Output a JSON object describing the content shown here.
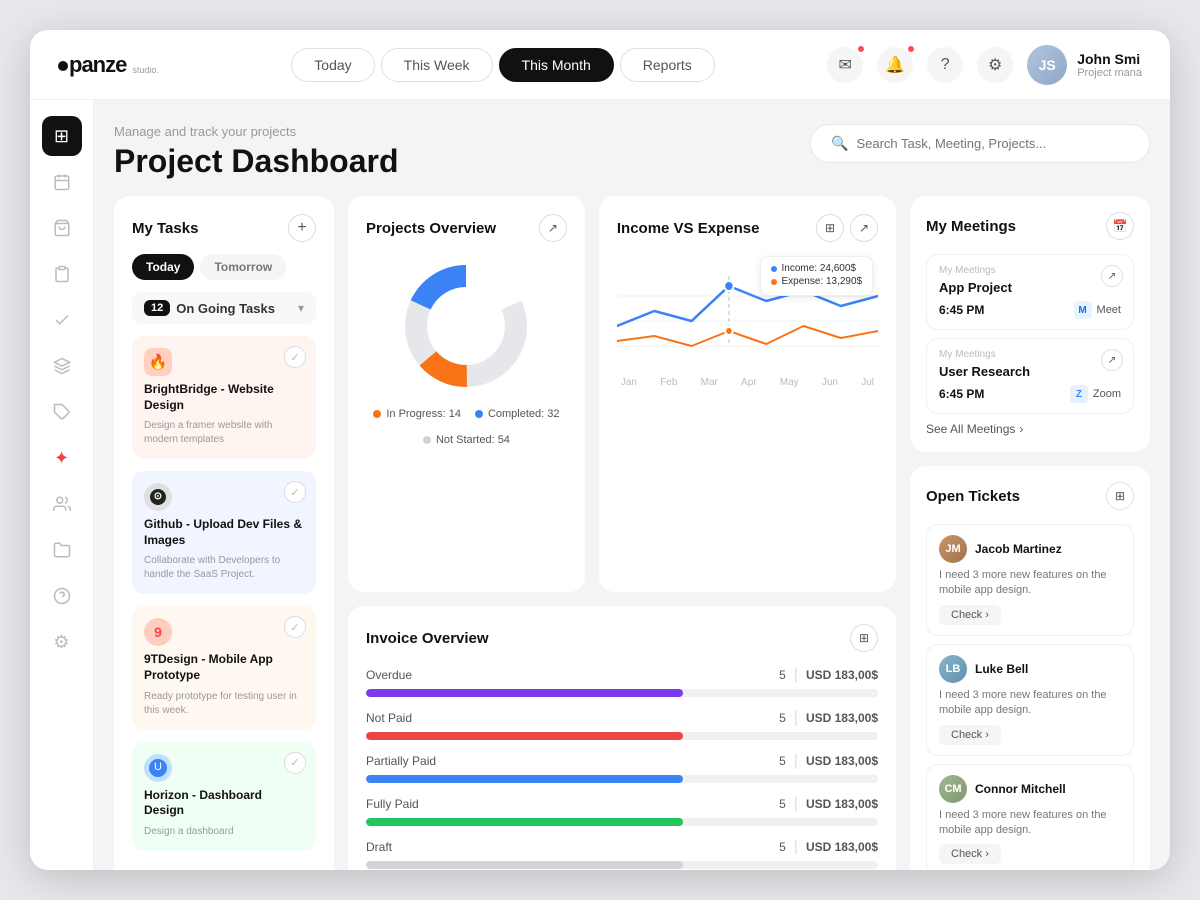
{
  "header": {
    "logo": "panze",
    "logo_sub": "studio.",
    "nav": [
      {
        "label": "Today",
        "active": false
      },
      {
        "label": "This Week",
        "active": false
      },
      {
        "label": "This Month",
        "active": true
      },
      {
        "label": "Reports",
        "active": false
      }
    ],
    "search_placeholder": "Search Task, Meeting, Projects...",
    "user": {
      "name": "John Smi",
      "role": "Project mana",
      "initials": "JS"
    }
  },
  "page": {
    "subtitle": "Manage and track your projects",
    "title": "Project Dashboard"
  },
  "tasks": {
    "title": "My Tasks",
    "tabs": [
      "Today",
      "Tomorrow"
    ],
    "ongoing_count": "12",
    "ongoing_label": "On Going Tasks",
    "items": [
      {
        "name": "BrightBridge - Website Design",
        "desc": "Design a framer website with modern templates",
        "icon": "🔴",
        "color": "#fff5f0"
      },
      {
        "name": "Github - Upload Dev Files & Images",
        "desc": "Collaborate with Developers to handle the SaaS Project.",
        "icon": "⚫",
        "color": "#f0f5ff"
      },
      {
        "name": "9TDesign - Mobile App Prototype",
        "desc": "Ready prototype for testing user in this week.",
        "icon": "🔴",
        "color": "#fff8f0"
      },
      {
        "name": "Horizon - Dashboard Design",
        "desc": "Design a dashboard",
        "icon": "⭕",
        "color": "#f0fff4"
      }
    ]
  },
  "projects_overview": {
    "title": "Projects Overview",
    "in_progress": 14,
    "completed": 32,
    "not_started": 54,
    "legend": [
      {
        "label": "In Progress: 14",
        "color": "#f97316"
      },
      {
        "label": "Completed: 32",
        "color": "#3b82f6"
      },
      {
        "label": "Not Started: 54",
        "color": "#e5e7eb"
      }
    ]
  },
  "income_expense": {
    "title": "Income VS Expense",
    "tooltip": {
      "income": "Income: 24,600$",
      "expense": "Expense: 13,290$"
    },
    "labels": [
      "Jan",
      "Feb",
      "Mar",
      "Apr",
      "May",
      "Jun",
      "Jul"
    ]
  },
  "invoice_overview": {
    "title": "Invoice Overview",
    "rows": [
      {
        "label": "Overdue",
        "count": 5,
        "amount": "USD 183,00$",
        "color": "#7c3aed",
        "fill": 62
      },
      {
        "label": "Not Paid",
        "count": 5,
        "amount": "USD 183,00$",
        "color": "#ef4444",
        "fill": 62
      },
      {
        "label": "Partially Paid",
        "count": 5,
        "amount": "USD 183,00$",
        "color": "#3b82f6",
        "fill": 62
      },
      {
        "label": "Fully Paid",
        "count": 5,
        "amount": "USD 183,00$",
        "color": "#22c55e",
        "fill": 62
      },
      {
        "label": "Draft",
        "count": 5,
        "amount": "USD 183,00$",
        "color": "#d1d5db",
        "fill": 62
      }
    ]
  },
  "meetings": {
    "title": "My Meetings",
    "items": [
      {
        "meta": "My Meetings",
        "title": "App Project",
        "time": "6:45 PM",
        "platform": "Meet",
        "platform_icon": "M"
      },
      {
        "meta": "My Meetings",
        "title": "User Research",
        "time": "6:45 PM",
        "platform": "Zoom",
        "platform_icon": "Z"
      }
    ],
    "see_all": "See All Meetings"
  },
  "tickets": {
    "title": "Open Tickets",
    "items": [
      {
        "name": "Jacob Martinez",
        "initials": "JM",
        "msg": "I need 3 more new features on the mobile app design.",
        "check": "Check"
      },
      {
        "name": "Luke Bell",
        "initials": "LB",
        "msg": "I need 3 more new features on the mobile app design.",
        "check": "Check"
      },
      {
        "name": "Connor Mitchell",
        "initials": "CM",
        "msg": "I need 3 more new features on the mobile app design.",
        "check": "Check"
      }
    ]
  },
  "sidebar": {
    "icons": [
      {
        "name": "grid",
        "symbol": "⊞",
        "active": true
      },
      {
        "name": "calendar",
        "symbol": "📅",
        "active": false
      },
      {
        "name": "bag",
        "symbol": "🛍",
        "active": false
      },
      {
        "name": "clipboard",
        "symbol": "📋",
        "active": false
      },
      {
        "name": "check",
        "symbol": "✓",
        "active": false
      },
      {
        "name": "layers",
        "symbol": "◫",
        "active": false
      },
      {
        "name": "tag",
        "symbol": "🏷",
        "active": false
      },
      {
        "name": "star",
        "symbol": "✦",
        "active": false
      },
      {
        "name": "users",
        "symbol": "👥",
        "active": false
      },
      {
        "name": "folder",
        "symbol": "🗂",
        "active": false
      },
      {
        "name": "help",
        "symbol": "?",
        "active": false
      },
      {
        "name": "settings",
        "symbol": "⚙",
        "active": false
      }
    ]
  }
}
